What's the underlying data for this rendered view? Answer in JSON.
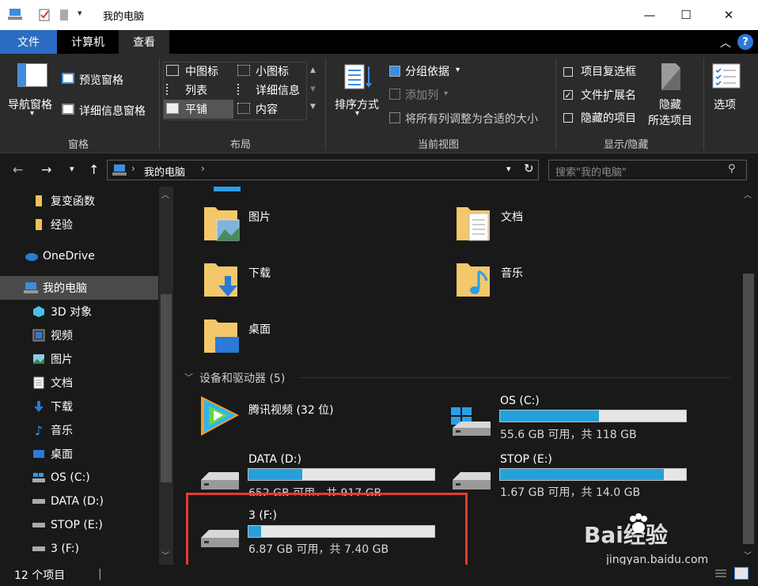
{
  "window": {
    "title": "我的电脑"
  },
  "tabs": [
    {
      "label": "文件"
    },
    {
      "label": "计算机"
    },
    {
      "label": "查看"
    }
  ],
  "ribbon": {
    "panes": {
      "nav_pane": "导航窗格",
      "preview": "预览窗格",
      "details": "详细信息窗格",
      "group": "窗格"
    },
    "layout": {
      "items": [
        "中图标",
        "小图标",
        "列表",
        "详细信息",
        "平铺",
        "内容"
      ],
      "group": "布局"
    },
    "view": {
      "sort": "排序方式",
      "group_by": "分组依据",
      "add_col": "添加列",
      "fit_cols": "将所有列调整为合适的大小",
      "group": "当前视图"
    },
    "show": {
      "item_cb": "项目复选框",
      "ext": "文件扩展名",
      "hidden_items": "隐藏的项目",
      "hide": "隐藏",
      "hide2": "所选项目",
      "group": "显示/隐藏"
    },
    "options": "选项"
  },
  "address": {
    "path": "我的电脑",
    "search_placeholder": "搜索\"我的电脑\""
  },
  "nav": {
    "items": [
      "复变函数",
      "经验",
      "OneDrive",
      "我的电脑",
      "3D 对象",
      "视频",
      "图片",
      "文档",
      "下载",
      "音乐",
      "桌面",
      "OS (C:)",
      "DATA (D:)",
      "STOP (E:)",
      "3 (F:)"
    ]
  },
  "content": {
    "folders": [
      "图片",
      "文档",
      "下载",
      "音乐",
      "桌面"
    ],
    "devices_header": "设备和驱动器 (5)",
    "app": "腾讯视频 (32 位)",
    "drives": [
      {
        "name": "OS (C:)",
        "info": "55.6 GB 可用，共 118 GB",
        "used": 0.53
      },
      {
        "name": "DATA (D:)",
        "info": "652 GB 可用，共 917 GB",
        "used": 0.29
      },
      {
        "name": "STOP (E:)",
        "info": "1.67 GB 可用，共 14.0 GB",
        "used": 0.88
      },
      {
        "name": "3 (F:)",
        "info": "6.87 GB 可用，共 7.40 GB",
        "used": 0.07
      }
    ]
  },
  "status": {
    "count": "12 个项目"
  },
  "watermark": {
    "brand": "Bai经验",
    "url": "jingyan.baidu.com"
  },
  "colors": {
    "accent": "#26a0da",
    "highlight": "#e53935"
  }
}
